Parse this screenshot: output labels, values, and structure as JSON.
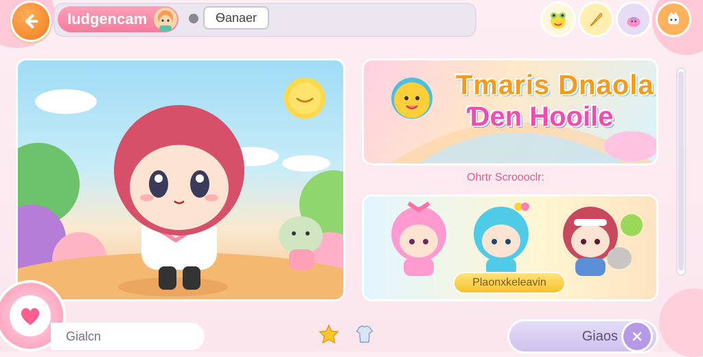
{
  "header": {
    "title": "Iudgencam",
    "search_value": "Ѳanaer"
  },
  "banner": {
    "line1": "Tmaris Dnaola",
    "line2": "Ɗen Hooile"
  },
  "section": {
    "label": "Ohrtr Scroooclr:"
  },
  "characters": {
    "name_label": "Plaonxkeleavin"
  },
  "footer": {
    "left_label": "Gialcn",
    "right_button_label": "Giaos"
  },
  "icons": {
    "back": "back-arrow-icon",
    "top_right": [
      "frog-icon",
      "feather-icon",
      "bag-icon",
      "crown-icon"
    ],
    "bottom_center": [
      "star-icon",
      "shirt-icon"
    ],
    "heart": "heart-icon",
    "close": "close-icon"
  },
  "colors": {
    "accent_orange": "#f07a1c",
    "accent_pink": "#f77b9c",
    "accent_purple": "#b69ae8"
  }
}
